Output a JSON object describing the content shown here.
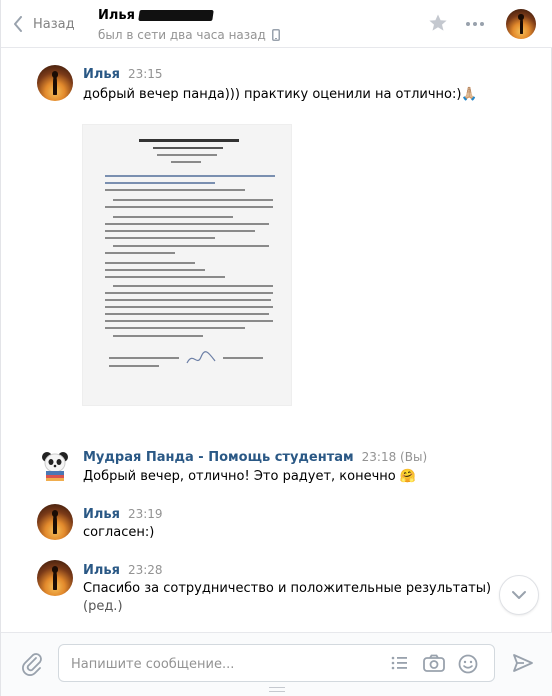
{
  "header": {
    "back_label": "Назад",
    "peer_name": "Илья",
    "peer_status": "был в сети два часа назад"
  },
  "messages": [
    {
      "author": "Илья",
      "time": "23:15",
      "text": "добрый вечер панда))) практику оценили на отлично:)🙏🏼"
    },
    {
      "author": "Мудрая Панда - Помощь студентам",
      "time": "23:18 (Вы)",
      "text": "Добрый вечер, отлично! Это радует, конечно 🤗"
    },
    {
      "author": "Илья",
      "time": "23:19",
      "text": "согласен:)"
    },
    {
      "author": "Илья",
      "time": "23:28",
      "text": "Спасибо за сотрудничество и положительные результаты)",
      "edited": "(ред.)"
    }
  ],
  "compose": {
    "placeholder": "Напишите сообщение..."
  },
  "icons": {
    "back": "chevron-left-icon",
    "star": "star-icon",
    "more": "more-icon",
    "phone": "mobile-phone-icon",
    "scroll": "chevron-down-icon",
    "attach": "paperclip-icon",
    "template": "list-icon",
    "camera": "camera-icon",
    "emoji": "smile-icon",
    "send": "send-icon"
  },
  "colors": {
    "link": "#2a5885",
    "muted": "#939393",
    "icon": "#99a2ad"
  }
}
